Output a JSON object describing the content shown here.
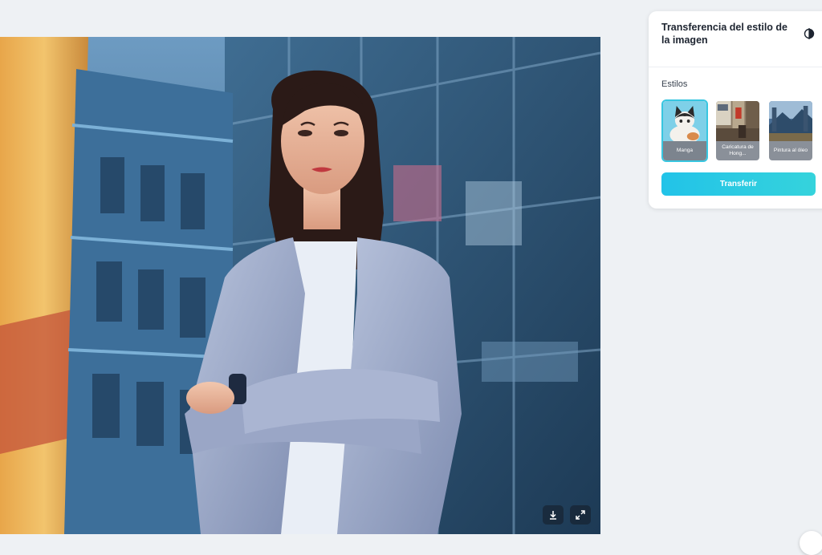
{
  "panel": {
    "title": "Transferencia del estilo de la imagen",
    "header_icon": "compare-icon",
    "styles_label": "Estilos",
    "styles": [
      {
        "label": "Manga",
        "selected": true,
        "thumb": "manga-cat"
      },
      {
        "label": "Caricatura de Hong...",
        "selected": false,
        "thumb": "hongkong-street"
      },
      {
        "label": "Pintura al óleo",
        "selected": false,
        "thumb": "oil-landscape"
      }
    ],
    "transfer_label": "Transferir"
  },
  "image": {
    "subject": "businesswoman-arms-crossed-cartoon-style",
    "actions": [
      "download-icon",
      "fullscreen-icon"
    ]
  },
  "colors": {
    "accent": "#22c3e8",
    "selected_border": "#38c6e0",
    "page_bg": "#eef1f4"
  }
}
